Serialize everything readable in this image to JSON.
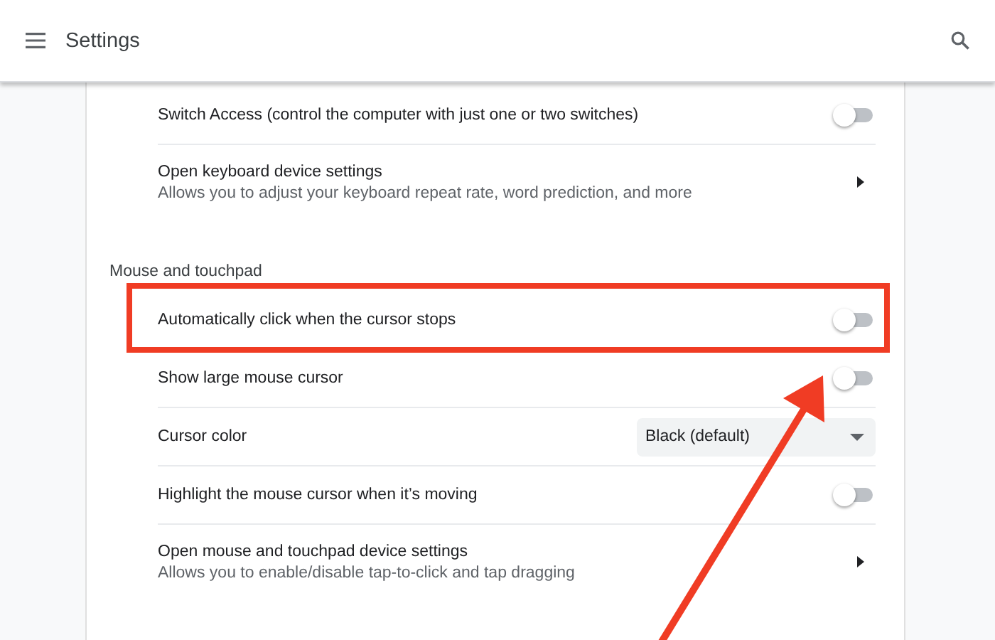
{
  "header": {
    "title": "Settings"
  },
  "sections": [
    {
      "rows": [
        {
          "kind": "toggle",
          "label": "Switch Access (control the computer with just one or two switches)",
          "on": false,
          "highlighted": false
        },
        {
          "kind": "link",
          "label": "Open keyboard device settings",
          "description": "Allows you to adjust your keyboard repeat rate, word prediction, and more",
          "highlighted": false
        }
      ]
    },
    {
      "title": "Mouse and touchpad",
      "rows": [
        {
          "kind": "toggle",
          "label": "Automatically click when the cursor stops",
          "on": false,
          "highlighted": true
        },
        {
          "kind": "toggle",
          "label": "Show large mouse cursor",
          "on": false,
          "highlighted": false
        },
        {
          "kind": "dropdown",
          "label": "Cursor color",
          "value": "Black (default)",
          "highlighted": false
        },
        {
          "kind": "toggle",
          "label": "Highlight the mouse cursor when it’s moving",
          "on": false,
          "highlighted": false
        },
        {
          "kind": "link",
          "label": "Open mouse and touchpad device settings",
          "description": "Allows you to enable/disable tap-to-click and tap dragging",
          "highlighted": false
        }
      ]
    }
  ]
}
